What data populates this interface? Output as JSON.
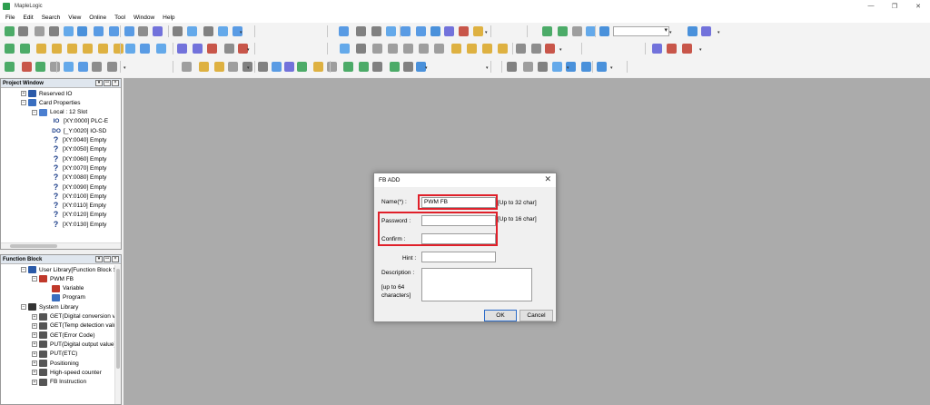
{
  "app": {
    "title": "MapleLogic"
  },
  "window_controls": [
    "—",
    "❐",
    "✕"
  ],
  "menu": [
    "File",
    "Edit",
    "Search",
    "View",
    "Online",
    "Tool",
    "Window",
    "Help"
  ],
  "project_window": {
    "title": "Project Window",
    "buttons": [
      "▾",
      "ꟷ",
      "×"
    ],
    "items": [
      {
        "label": "Reserved IO",
        "icon": "reserved-io-icon",
        "level": 1,
        "expander": "+"
      },
      {
        "label": "Card Properties",
        "icon": "card-properties-icon",
        "level": 1,
        "expander": "−"
      },
      {
        "label": "Local : 12 Slot",
        "icon": "local-slot-icon",
        "level": 2,
        "expander": "−"
      },
      {
        "label": "[XY:0000] PLC-E",
        "icon_text": "IO",
        "level": 3
      },
      {
        "label": "[_Y:0020] IO-SD",
        "icon_text": "DO",
        "level": 3
      },
      {
        "label": "[XY:0040] Empty",
        "icon_text": "?",
        "level": 3
      },
      {
        "label": "[XY:0050] Empty",
        "icon_text": "?",
        "level": 3
      },
      {
        "label": "[XY:0060] Empty",
        "icon_text": "?",
        "level": 3
      },
      {
        "label": "[XY:0070] Empty",
        "icon_text": "?",
        "level": 3
      },
      {
        "label": "[XY:0080] Empty",
        "icon_text": "?",
        "level": 3
      },
      {
        "label": "[XY:0090] Empty",
        "icon_text": "?",
        "level": 3
      },
      {
        "label": "[XY:0100] Empty",
        "icon_text": "?",
        "level": 3
      },
      {
        "label": "[XY:0110] Empty",
        "icon_text": "?",
        "level": 3
      },
      {
        "label": "[XY:0120] Empty",
        "icon_text": "?",
        "level": 3
      },
      {
        "label": "[XY:0130] Empty",
        "icon_text": "?",
        "level": 3
      }
    ]
  },
  "function_block": {
    "title": "Function Block",
    "buttons": [
      "▾",
      "ꟷ",
      "×"
    ],
    "items": [
      {
        "label": "User Library[Function Block Sa",
        "icon": "user-library-icon",
        "level": 1,
        "expander": "−"
      },
      {
        "label": "PWM FB",
        "icon": "function-block-icon",
        "level": 2,
        "expander": "−"
      },
      {
        "label": "Variable",
        "icon": "variable-icon",
        "level": 3
      },
      {
        "label": "Program",
        "icon": "program-icon",
        "level": 3
      },
      {
        "label": "System Library",
        "icon": "system-library-icon",
        "level": 1,
        "expander": "−"
      },
      {
        "label": "GET(Digital conversion valu",
        "icon": "library-item-icon",
        "level": 2,
        "expander": "+"
      },
      {
        "label": "GET(Temp detection valu",
        "icon": "library-item-icon",
        "level": 2,
        "expander": "+"
      },
      {
        "label": "GET(Error Code)",
        "icon": "library-item-icon",
        "level": 2,
        "expander": "+"
      },
      {
        "label": "PUT(Digital output value)",
        "icon": "library-item-icon",
        "level": 2,
        "expander": "+"
      },
      {
        "label": "PUT(ETC)",
        "icon": "library-item-icon",
        "level": 2,
        "expander": "+"
      },
      {
        "label": "Positioning",
        "icon": "library-item-icon",
        "level": 2,
        "expander": "+"
      },
      {
        "label": "High-speed counter",
        "icon": "library-item-icon",
        "level": 2,
        "expander": "+"
      },
      {
        "label": "FB Instruction",
        "icon": "library-item-icon",
        "level": 2,
        "expander": "+"
      }
    ]
  },
  "dialog": {
    "title": "FB ADD",
    "close": "✕",
    "name_label": "Name(*) :",
    "name_value": "PWM FB",
    "name_note": "[Up to 32 char]",
    "password_label": "Password :",
    "password_value": "",
    "password_note": "[Up to 16 char]",
    "confirm_label": "Confirm :",
    "confirm_value": "",
    "hint_label": "Hint :",
    "hint_value": "",
    "description_label": "Description :",
    "description_note_1": "[up to 64",
    "description_note_2": "characters]",
    "description_value": "",
    "ok_label": "OK",
    "cancel_label": "Cancel"
  },
  "colors": {
    "workspace": "#ababab",
    "highlight_box": "#e0202a",
    "app_icon": "#2e9e4f"
  }
}
